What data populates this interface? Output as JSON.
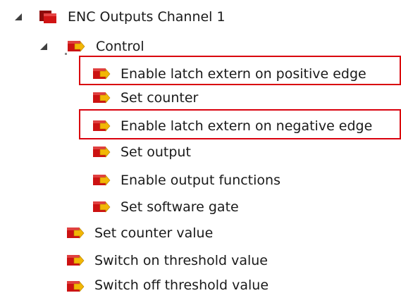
{
  "tree": {
    "root": {
      "label": "ENC Outputs Channel 1",
      "expanded": true,
      "icon": "channel-object-icon"
    },
    "control": {
      "label": "Control",
      "expanded": true,
      "icon": "output-variable-icon"
    },
    "control_items": [
      {
        "label": "Enable latch extern on positive edge",
        "icon": "output-variable-icon",
        "highlighted": true
      },
      {
        "label": "Set counter",
        "icon": "output-variable-icon",
        "highlighted": false
      },
      {
        "label": "Enable latch extern on negative edge",
        "icon": "output-variable-icon",
        "highlighted": true
      },
      {
        "label": "Set output",
        "icon": "output-variable-icon",
        "highlighted": false
      },
      {
        "label": "Enable output functions",
        "icon": "output-variable-icon",
        "highlighted": false
      },
      {
        "label": "Set software gate",
        "icon": "output-variable-icon",
        "highlighted": false
      }
    ],
    "channel_items": [
      {
        "label": "Set counter value",
        "icon": "output-variable-icon"
      },
      {
        "label": "Switch on threshold value",
        "icon": "output-variable-icon"
      },
      {
        "label": "Switch off threshold value",
        "icon": "output-variable-icon"
      }
    ]
  },
  "colors": {
    "highlight_border": "#d9000d",
    "icon_red": "#cc1212",
    "icon_dark_red": "#8f0b0b",
    "arrow_yellow": "#f2b705"
  }
}
